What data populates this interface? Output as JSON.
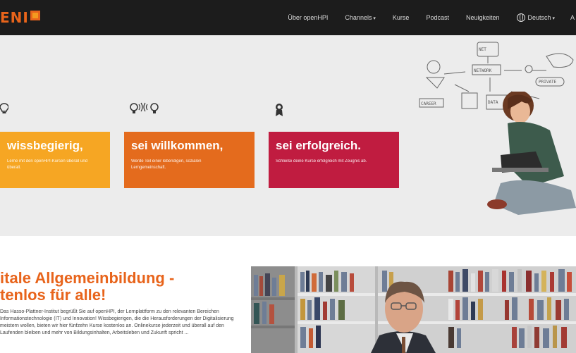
{
  "nav": {
    "logo_text": "ENI",
    "links": [
      "Über openHPI",
      "Channels",
      "Kurse",
      "Podcast",
      "Neuigkeiten"
    ],
    "language": "Deutsch",
    "cut_item": "A"
  },
  "hero": {
    "cards": [
      {
        "title": "wissbegierig,",
        "text": "Lerne mit den openHPI-Kursen überall und überall."
      },
      {
        "title": "sei willkommen,",
        "text": "Werde Teil einer lebendigen, sozialen Lerngemeinschaft."
      },
      {
        "title": "sei erfolgreich.",
        "text": "Schließe deine Kurse erfolgreich mit Zeugnis ab."
      }
    ],
    "sketch_labels": [
      "NET",
      "NETWORK",
      "CAREER",
      "DATA",
      "PRIVATE"
    ]
  },
  "intro": {
    "heading": "Digitale Allgemeinbildung – kostenlos für alle!",
    "heading_line1": "itale Allgemeinbildung -",
    "heading_line2": "tenlos für alle!",
    "text": "Das Hasso-Plattner-Institut begrüßt Sie auf openHPI, der Lernplattform zu den relevanten Bereichen Informationstechnologie (IT) und Innovation! Wissbegierigen, die die Herausforderungen der Digitalisierung meistern wollen, bieten wir hier fünfzehn Kurse kostenlos an. Onlinekurse jederzeit und überall auf den Laufenden bleiben und mehr von Bildungsinhalten, Arbeitsleben und Zukunft spricht ..."
  },
  "colors": {
    "nav_bg": "#1c1c1c",
    "accent": "#e8641b",
    "card_yellow": "#f6a623",
    "card_orange": "#e46b1d",
    "card_red": "#c01c40",
    "hero_bg": "#ececec"
  },
  "icons": [
    "globe-icon",
    "signal-bulb-icon",
    "award-icon"
  ]
}
